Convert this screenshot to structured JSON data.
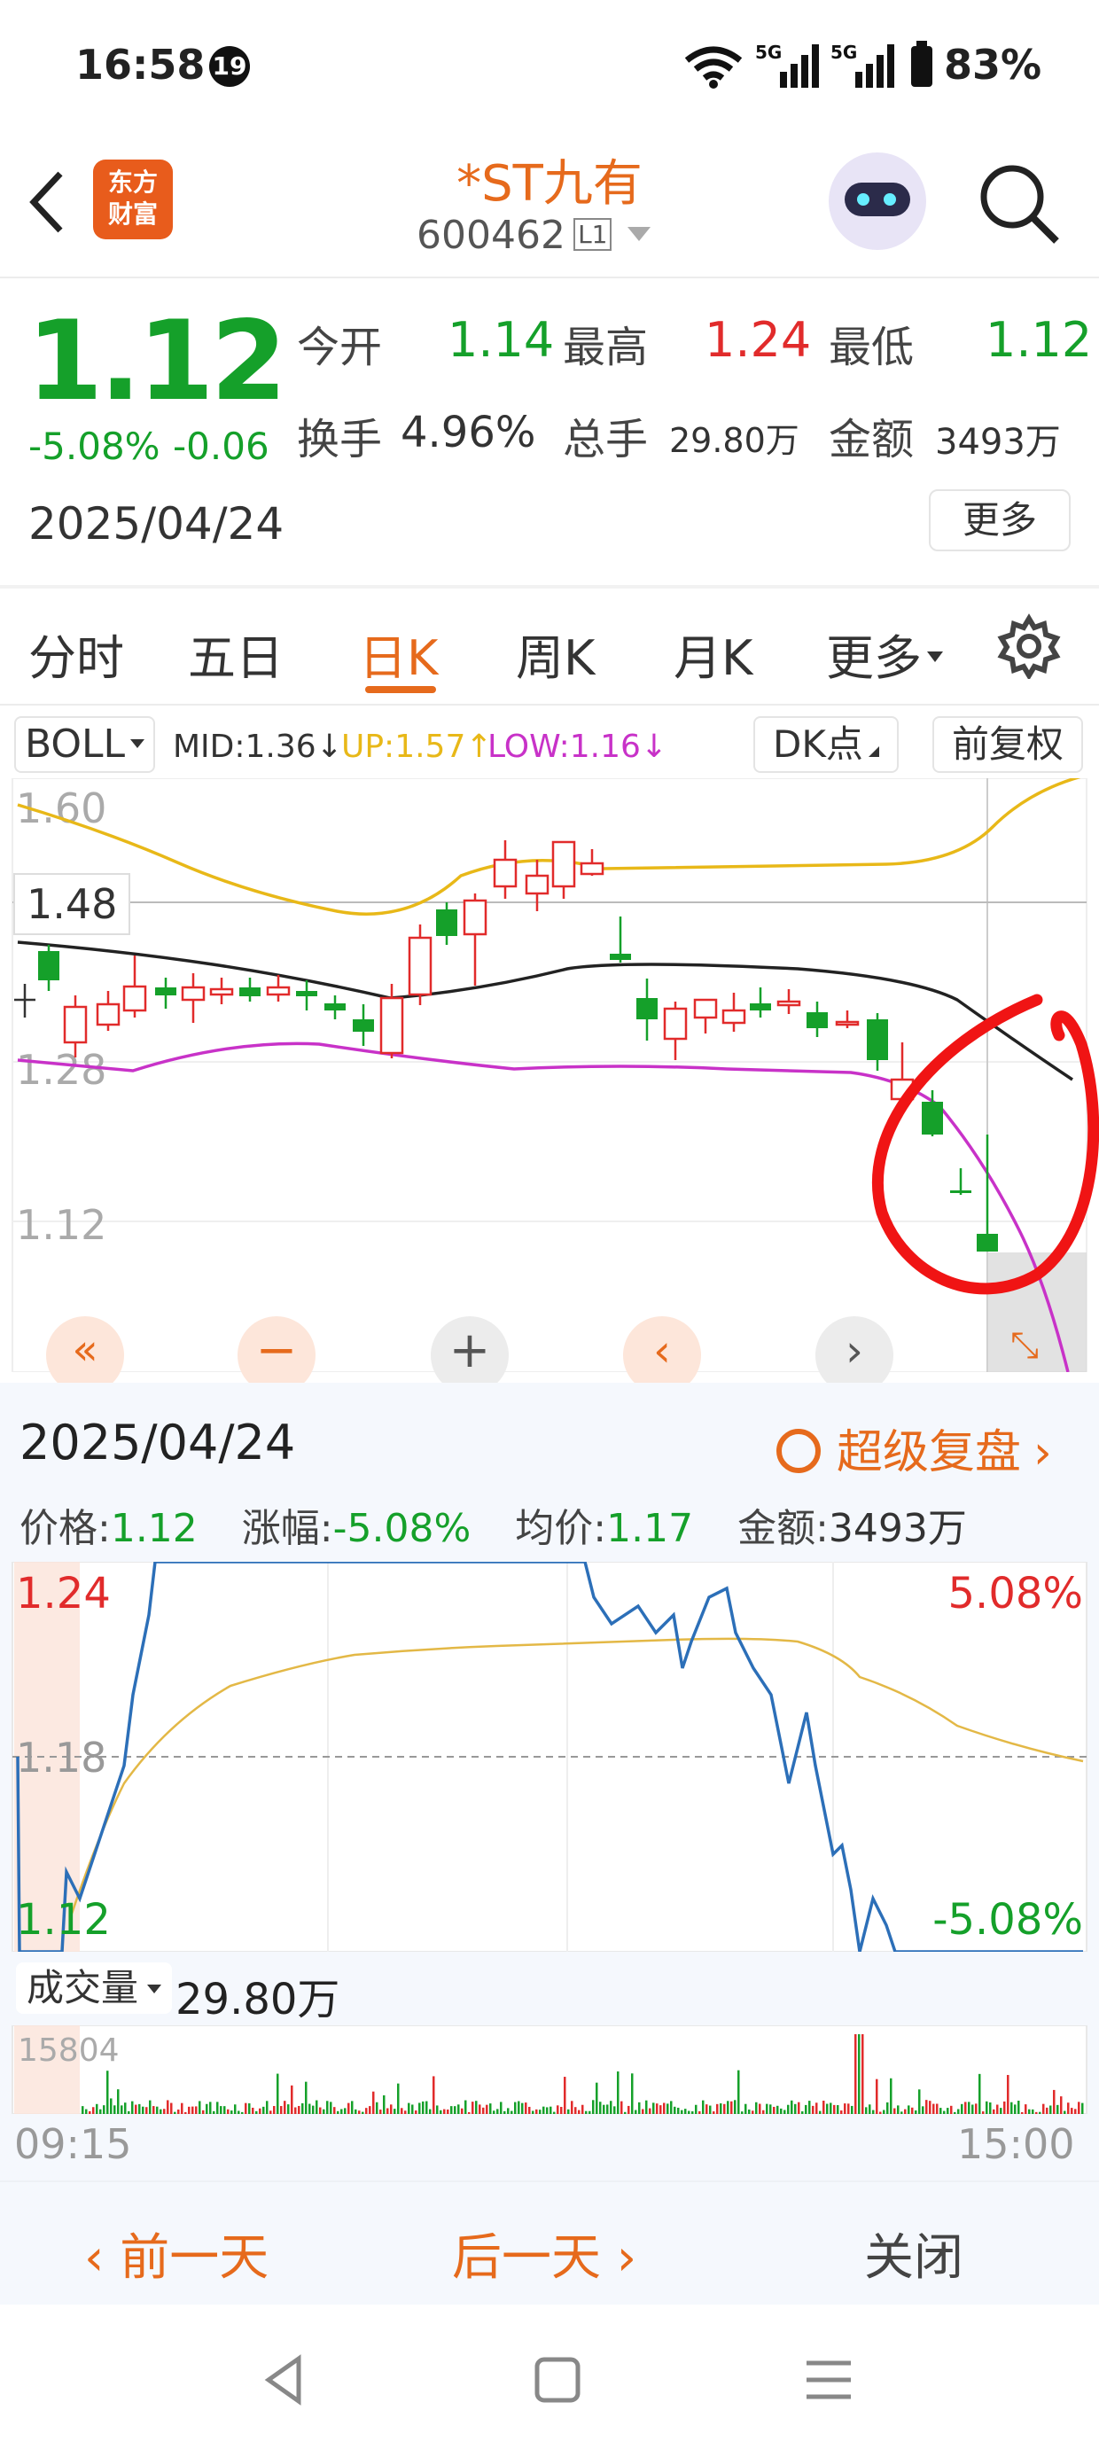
{
  "status": {
    "time": "16:58",
    "badge": "19",
    "net1": "5G",
    "net2": "5G",
    "battery": "83%"
  },
  "header": {
    "app_logo": "东方\n财富",
    "stock_name": "*ST九有",
    "code": "600462",
    "level": "L1"
  },
  "quote": {
    "price": "1.12",
    "change_pct": "-5.08%",
    "change_abs": "-0.06",
    "date": "2025/04/24",
    "open_label": "今开",
    "open": "1.14",
    "high_label": "最高",
    "high": "1.24",
    "low_label": "最低",
    "low": "1.12",
    "turnover_label": "换手",
    "turnover": "4.96%",
    "volume_label": "总手",
    "volume": "29.80万",
    "amount_label": "金额",
    "amount": "3493万",
    "more_label": "更多"
  },
  "tabs": [
    "分时",
    "五日",
    "日K",
    "周K",
    "月K",
    "更多"
  ],
  "active_tab": "日K",
  "kline": {
    "indicator": "BOLL",
    "mid": "MID:1.36↓",
    "up": "UP:1.57↑",
    "low": "LOW:1.16↓",
    "dk_label": "DK点",
    "fq_label": "前复权",
    "price_labels": [
      "1.60",
      "1.48",
      "1.28",
      "1.12"
    ]
  },
  "detail": {
    "date": "2025/04/24",
    "replay_label": "超级复盘",
    "price_label": "价格:",
    "price": "1.12",
    "pct_label": "涨幅:",
    "pct": "-5.08%",
    "avg_label": "均价:",
    "avg": "1.17",
    "amount_label": "金额:",
    "amount": "3493万",
    "y_top": "1.24",
    "y_mid": "1.18",
    "y_bot": "1.12",
    "pct_top": "5.08%",
    "pct_bot": "-5.08%",
    "vol_selector": "成交量",
    "vol_value": "29.80万",
    "vol_max": "15804",
    "t_start": "09:15",
    "t_end": "15:00"
  },
  "bottom_actions": {
    "prev": "前一天",
    "next": "后一天",
    "close": "关闭"
  },
  "colors": {
    "up": "#e12b2b",
    "down": "#15a02a",
    "accent": "#e66a1c",
    "boll_up": "#e8b818",
    "boll_low": "#c832c8",
    "price_line": "#2c6fb8"
  }
}
